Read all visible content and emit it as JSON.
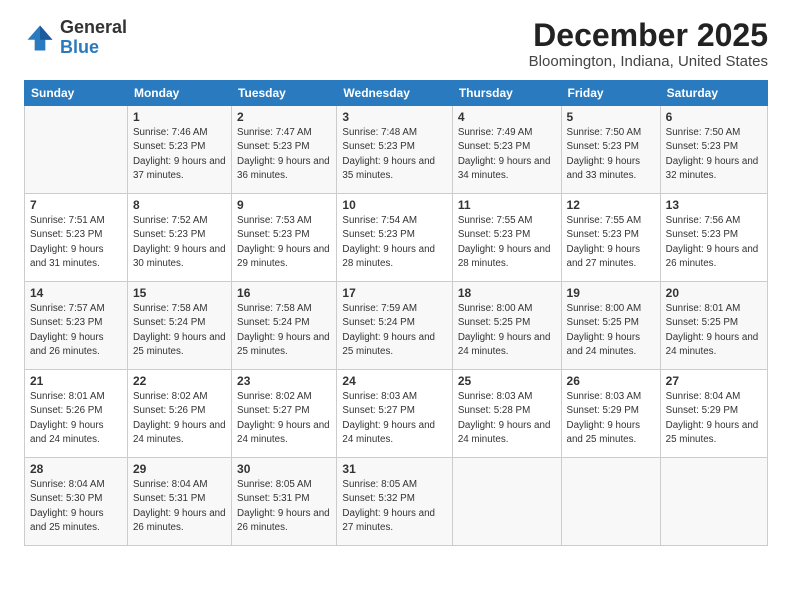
{
  "header": {
    "logo_line1": "General",
    "logo_line2": "Blue",
    "title": "December 2025",
    "subtitle": "Bloomington, Indiana, United States"
  },
  "days_of_week": [
    "Sunday",
    "Monday",
    "Tuesday",
    "Wednesday",
    "Thursday",
    "Friday",
    "Saturday"
  ],
  "weeks": [
    [
      {
        "day": null
      },
      {
        "day": "1",
        "sunrise": "7:46 AM",
        "sunset": "5:23 PM",
        "daylight": "9 hours and 37 minutes."
      },
      {
        "day": "2",
        "sunrise": "7:47 AM",
        "sunset": "5:23 PM",
        "daylight": "9 hours and 36 minutes."
      },
      {
        "day": "3",
        "sunrise": "7:48 AM",
        "sunset": "5:23 PM",
        "daylight": "9 hours and 35 minutes."
      },
      {
        "day": "4",
        "sunrise": "7:49 AM",
        "sunset": "5:23 PM",
        "daylight": "9 hours and 34 minutes."
      },
      {
        "day": "5",
        "sunrise": "7:50 AM",
        "sunset": "5:23 PM",
        "daylight": "9 hours and 33 minutes."
      },
      {
        "day": "6",
        "sunrise": "7:50 AM",
        "sunset": "5:23 PM",
        "daylight": "9 hours and 32 minutes."
      }
    ],
    [
      {
        "day": "7",
        "sunrise": "7:51 AM",
        "sunset": "5:23 PM",
        "daylight": "9 hours and 31 minutes."
      },
      {
        "day": "8",
        "sunrise": "7:52 AM",
        "sunset": "5:23 PM",
        "daylight": "9 hours and 30 minutes."
      },
      {
        "day": "9",
        "sunrise": "7:53 AM",
        "sunset": "5:23 PM",
        "daylight": "9 hours and 29 minutes."
      },
      {
        "day": "10",
        "sunrise": "7:54 AM",
        "sunset": "5:23 PM",
        "daylight": "9 hours and 28 minutes."
      },
      {
        "day": "11",
        "sunrise": "7:55 AM",
        "sunset": "5:23 PM",
        "daylight": "9 hours and 28 minutes."
      },
      {
        "day": "12",
        "sunrise": "7:55 AM",
        "sunset": "5:23 PM",
        "daylight": "9 hours and 27 minutes."
      },
      {
        "day": "13",
        "sunrise": "7:56 AM",
        "sunset": "5:23 PM",
        "daylight": "9 hours and 26 minutes."
      }
    ],
    [
      {
        "day": "14",
        "sunrise": "7:57 AM",
        "sunset": "5:23 PM",
        "daylight": "9 hours and 26 minutes."
      },
      {
        "day": "15",
        "sunrise": "7:58 AM",
        "sunset": "5:24 PM",
        "daylight": "9 hours and 25 minutes."
      },
      {
        "day": "16",
        "sunrise": "7:58 AM",
        "sunset": "5:24 PM",
        "daylight": "9 hours and 25 minutes."
      },
      {
        "day": "17",
        "sunrise": "7:59 AM",
        "sunset": "5:24 PM",
        "daylight": "9 hours and 25 minutes."
      },
      {
        "day": "18",
        "sunrise": "8:00 AM",
        "sunset": "5:25 PM",
        "daylight": "9 hours and 24 minutes."
      },
      {
        "day": "19",
        "sunrise": "8:00 AM",
        "sunset": "5:25 PM",
        "daylight": "9 hours and 24 minutes."
      },
      {
        "day": "20",
        "sunrise": "8:01 AM",
        "sunset": "5:25 PM",
        "daylight": "9 hours and 24 minutes."
      }
    ],
    [
      {
        "day": "21",
        "sunrise": "8:01 AM",
        "sunset": "5:26 PM",
        "daylight": "9 hours and 24 minutes."
      },
      {
        "day": "22",
        "sunrise": "8:02 AM",
        "sunset": "5:26 PM",
        "daylight": "9 hours and 24 minutes."
      },
      {
        "day": "23",
        "sunrise": "8:02 AM",
        "sunset": "5:27 PM",
        "daylight": "9 hours and 24 minutes."
      },
      {
        "day": "24",
        "sunrise": "8:03 AM",
        "sunset": "5:27 PM",
        "daylight": "9 hours and 24 minutes."
      },
      {
        "day": "25",
        "sunrise": "8:03 AM",
        "sunset": "5:28 PM",
        "daylight": "9 hours and 24 minutes."
      },
      {
        "day": "26",
        "sunrise": "8:03 AM",
        "sunset": "5:29 PM",
        "daylight": "9 hours and 25 minutes."
      },
      {
        "day": "27",
        "sunrise": "8:04 AM",
        "sunset": "5:29 PM",
        "daylight": "9 hours and 25 minutes."
      }
    ],
    [
      {
        "day": "28",
        "sunrise": "8:04 AM",
        "sunset": "5:30 PM",
        "daylight": "9 hours and 25 minutes."
      },
      {
        "day": "29",
        "sunrise": "8:04 AM",
        "sunset": "5:31 PM",
        "daylight": "9 hours and 26 minutes."
      },
      {
        "day": "30",
        "sunrise": "8:05 AM",
        "sunset": "5:31 PM",
        "daylight": "9 hours and 26 minutes."
      },
      {
        "day": "31",
        "sunrise": "8:05 AM",
        "sunset": "5:32 PM",
        "daylight": "9 hours and 27 minutes."
      },
      {
        "day": null
      },
      {
        "day": null
      },
      {
        "day": null
      }
    ]
  ],
  "labels": {
    "sunrise_prefix": "Sunrise: ",
    "sunset_prefix": "Sunset: ",
    "daylight_prefix": "Daylight: "
  }
}
